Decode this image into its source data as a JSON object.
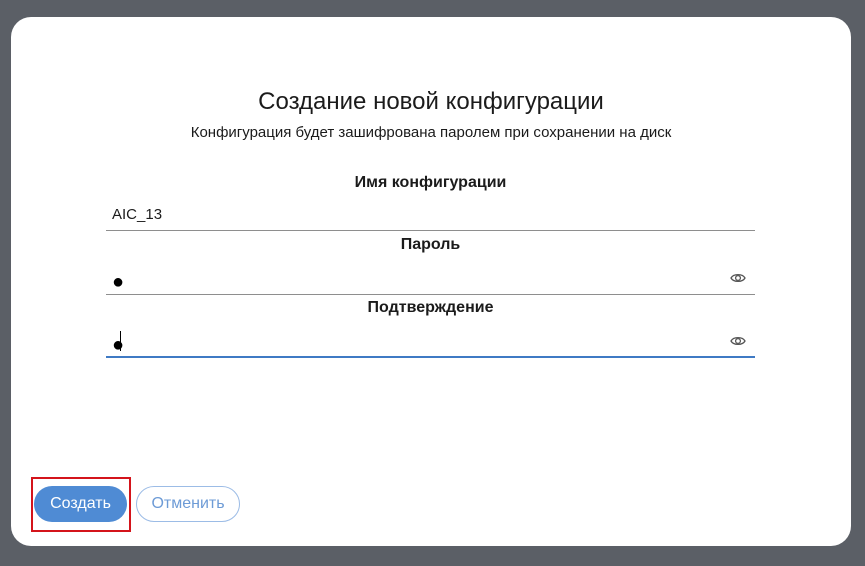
{
  "dialog": {
    "title": "Создание новой конфигурации",
    "subtitle": "Конфигурация будет зашифрована паролем при сохранении на диск"
  },
  "form": {
    "name_label": "Имя конфигурации",
    "name_value": "AIC_13",
    "password_label": "Пароль",
    "password_value": "●",
    "confirm_label": "Подтверждение",
    "confirm_value": "●",
    "eye_icon": "eye-icon"
  },
  "actions": {
    "create_label": "Создать",
    "cancel_label": "Отменить"
  },
  "colors": {
    "primary": "#4f8bd4",
    "focus_underline": "#3f7ac4",
    "highlight": "#d4141b",
    "backdrop": "#5b5f66"
  }
}
